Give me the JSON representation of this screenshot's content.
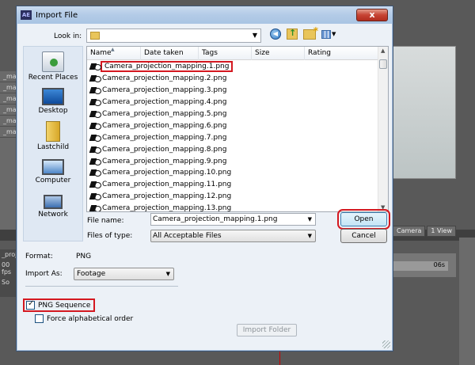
{
  "dialog": {
    "title": "Import File",
    "app_icon": "AE",
    "close_label": "x"
  },
  "toolbar": {
    "look_in_label": "Look in:",
    "look_in_value": "",
    "icons": [
      "back-icon",
      "up-folder-icon",
      "new-folder-icon",
      "view-menu-icon"
    ]
  },
  "places": [
    {
      "label": "Recent Places",
      "icon": "recent-places-icon"
    },
    {
      "label": "Desktop",
      "icon": "desktop-icon"
    },
    {
      "label": "Lastchild",
      "icon": "user-folder-icon"
    },
    {
      "label": "Computer",
      "icon": "computer-icon"
    },
    {
      "label": "Network",
      "icon": "network-icon"
    }
  ],
  "columns": [
    "Name",
    "Date taken",
    "Tags",
    "Size",
    "Rating"
  ],
  "files": [
    "Camera_projection_mapping.1.png",
    "Camera_projection_mapping.2.png",
    "Camera_projection_mapping.3.png",
    "Camera_projection_mapping.4.png",
    "Camera_projection_mapping.5.png",
    "Camera_projection_mapping.6.png",
    "Camera_projection_mapping.7.png",
    "Camera_projection_mapping.8.png",
    "Camera_projection_mapping.9.png",
    "Camera_projection_mapping.10.png",
    "Camera_projection_mapping.11.png",
    "Camera_projection_mapping.12.png",
    "Camera_projection_mapping.13.png"
  ],
  "selected_file_index": 0,
  "file_name": {
    "label": "File name:",
    "value": "Camera_projection_mapping.1.png"
  },
  "file_type": {
    "label": "Files of type:",
    "value": "All Acceptable Files"
  },
  "buttons": {
    "open": "Open",
    "cancel": "Cancel",
    "import_folder": "Import Folder"
  },
  "format": {
    "label": "Format:",
    "value": "PNG"
  },
  "import_as": {
    "label": "Import As:",
    "value": "Footage"
  },
  "png_sequence": {
    "label": "PNG Sequence",
    "checked": true
  },
  "force_alpha": {
    "label": "Force alphabetical order",
    "checked": false
  },
  "background": {
    "left_rows": [
      "_mappin",
      "_mappin",
      "_mappin",
      "_mappin",
      "_mappin",
      "_mappin"
    ],
    "left_lower": [
      "_proj",
      "00 fps",
      "So"
    ],
    "viewer_controls": [
      "Camera",
      "1 View"
    ],
    "timeline_marker": "06s"
  },
  "colors": {
    "highlight": "#d41820",
    "title_bar": "#b3cbe7",
    "dialog_bg": "#ecf1f7"
  }
}
